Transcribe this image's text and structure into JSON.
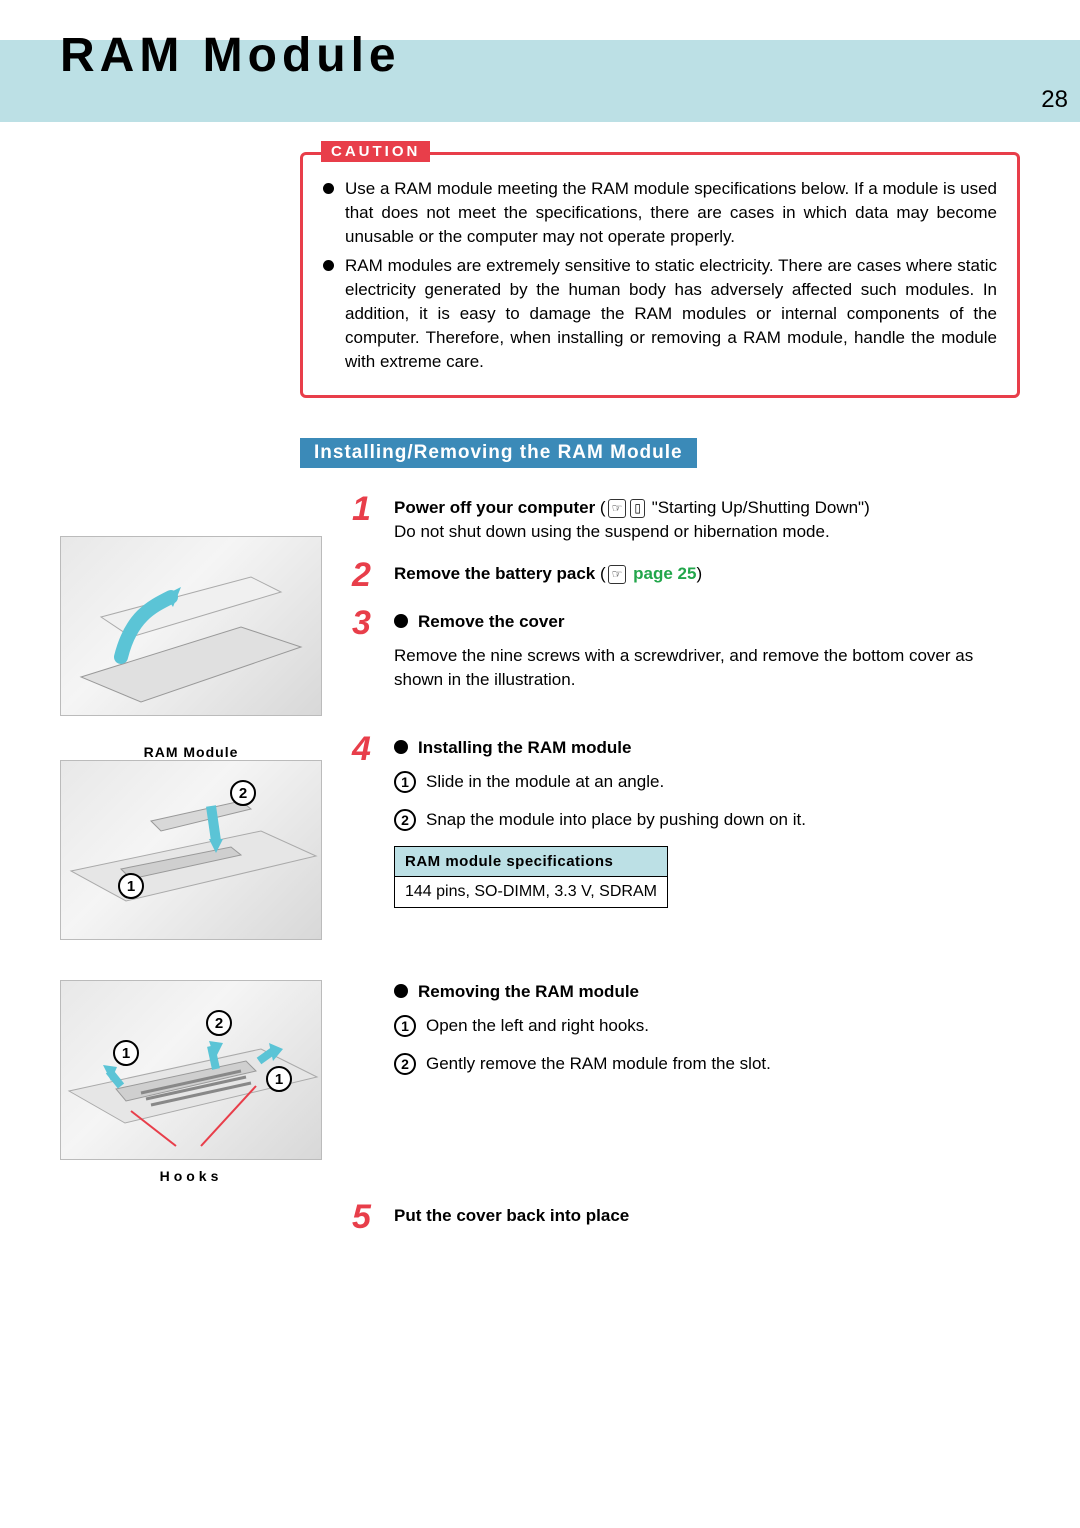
{
  "page": {
    "title": "RAM Module",
    "number": "28"
  },
  "caution": {
    "label": "CAUTION",
    "items": [
      "Use a RAM module meeting the RAM module specifications below.  If a module is used that does not meet the specifications, there are cases in which data may become unusable or the computer may not operate properly.",
      "RAM modules are extremely sensitive to static electricity.  There are cases where static electricity generated by the human body has adversely affected such modules.  In addition, it is easy to damage the RAM modules or internal components of the computer.  Therefore, when installing or removing a RAM module, handle the module with extreme care."
    ]
  },
  "section_heading": "Installing/Removing the RAM Module",
  "figures": {
    "ram_module_label": "RAM Module",
    "hooks_label": "Hooks"
  },
  "steps": {
    "s1": {
      "num": "1",
      "bold": "Power off your computer",
      "ref_quote": " \"Starting Up/Shutting Down\"",
      "body": "Do not shut down using the suspend or hibernation mode."
    },
    "s2": {
      "num": "2",
      "bold": "Remove the battery pack",
      "green": " page 25"
    },
    "s3": {
      "num": "3",
      "bold": "Remove the cover",
      "body": "Remove the nine screws with a screwdriver, and remove the bottom cover as shown in the illustration."
    },
    "s4": {
      "num": "4",
      "bold_install": "Installing the RAM module",
      "install_sub1": "Slide in the module at an angle.",
      "install_sub2": "Snap the module into place by pushing down on it.",
      "spec_header": "RAM module specifications",
      "spec_value": "144 pins, SO-DIMM, 3.3 V, SDRAM",
      "bold_remove": "Removing the RAM module",
      "remove_sub1": "Open the left and right hooks.",
      "remove_sub2": "Gently remove the RAM module from the slot."
    },
    "s5": {
      "num": "5",
      "bold": "Put the cover back into place"
    }
  }
}
